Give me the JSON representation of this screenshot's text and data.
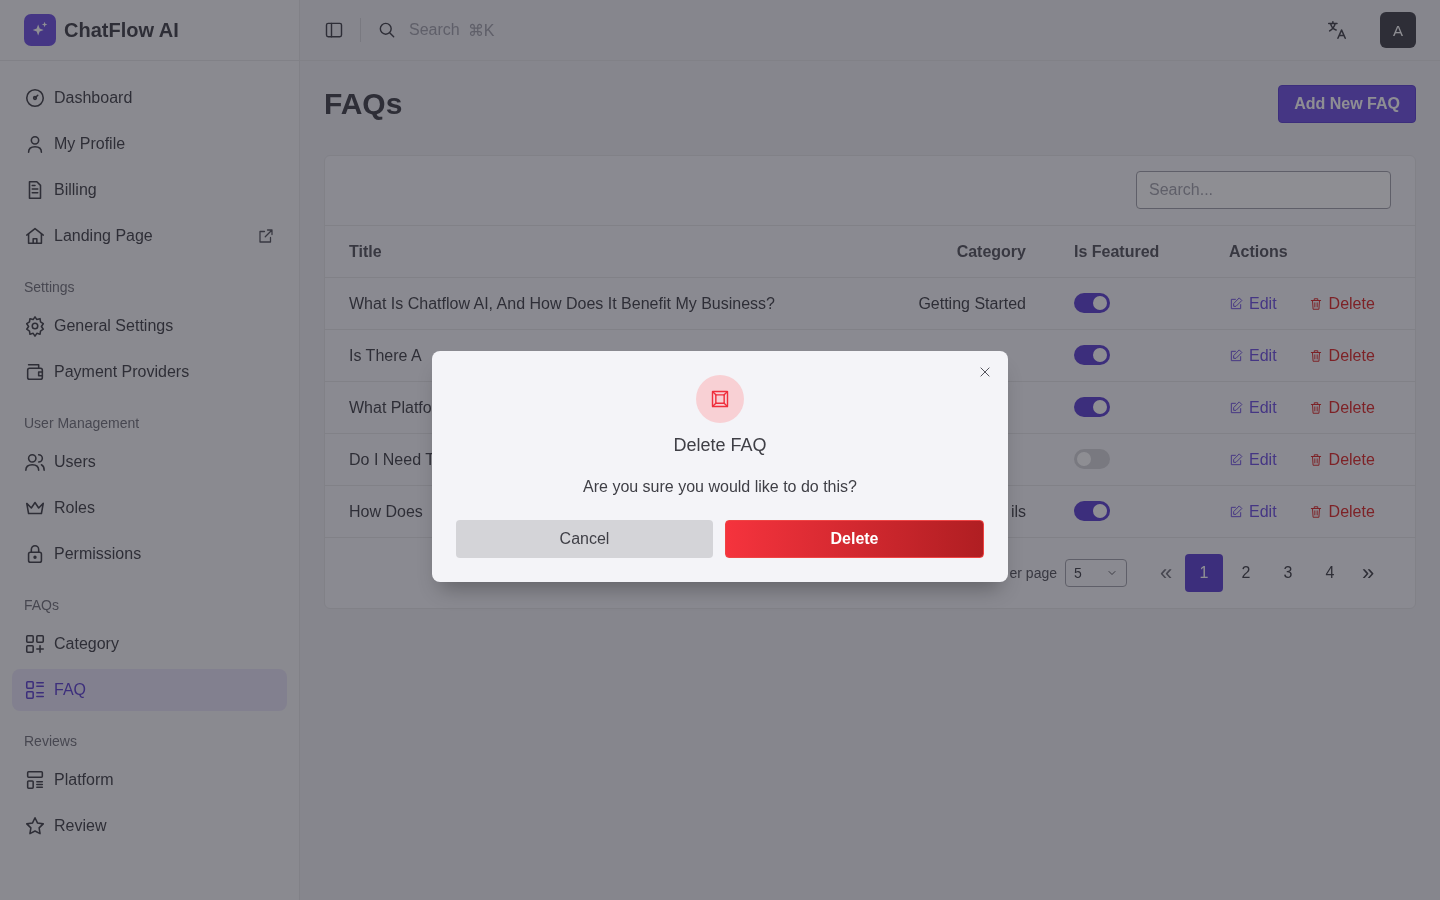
{
  "brand": {
    "name": "ChatFlow AI"
  },
  "topbar": {
    "search_placeholder": "Search",
    "shortcut": "⌘K",
    "avatar": "A"
  },
  "sidebar": {
    "sections": [
      {
        "items": [
          {
            "label": "Dashboard",
            "selected": false
          },
          {
            "label": "My Profile",
            "selected": false
          },
          {
            "label": "Billing",
            "selected": false
          },
          {
            "label": "Landing Page",
            "selected": false,
            "external": true
          }
        ]
      },
      {
        "heading": "Settings",
        "items": [
          {
            "label": "General Settings",
            "selected": false
          },
          {
            "label": "Payment Providers",
            "selected": false
          }
        ]
      },
      {
        "heading": "User Management",
        "items": [
          {
            "label": "Users",
            "selected": false
          },
          {
            "label": "Roles",
            "selected": false
          },
          {
            "label": "Permissions",
            "selected": false
          }
        ]
      },
      {
        "heading": "FAQs",
        "items": [
          {
            "label": "Category",
            "selected": false
          },
          {
            "label": "FAQ",
            "selected": true
          }
        ]
      },
      {
        "heading": "Reviews",
        "items": [
          {
            "label": "Platform",
            "selected": false
          },
          {
            "label": "Review",
            "selected": false
          }
        ]
      }
    ]
  },
  "page": {
    "title": "FAQs",
    "add_button": "Add New FAQ"
  },
  "table": {
    "search_placeholder": "Search...",
    "columns": [
      "Title",
      "Category",
      "Is Featured",
      "Actions"
    ],
    "rows": [
      {
        "title": "What Is Chatflow AI, And How Does It Benefit My Business?",
        "category": "Getting Started",
        "featured": true,
        "edit": "Edit",
        "delete": "Delete"
      },
      {
        "title": "Is There A",
        "featured": true,
        "edit": "Edit",
        "delete": "Delete"
      },
      {
        "title": "What Platfo",
        "featured": true,
        "edit": "Edit",
        "delete": "Delete"
      },
      {
        "title": "Do I Need T",
        "featured": false,
        "edit": "Edit",
        "delete": "Delete"
      },
      {
        "title": "How Does",
        "category": "ils",
        "featured": true,
        "edit": "Edit",
        "delete": "Delete"
      }
    ],
    "pagination": {
      "per_page_label": "er page",
      "per_page": "5",
      "first": "«",
      "last": "»",
      "pages": [
        {
          "label": "1",
          "selected": true
        },
        {
          "label": "2",
          "selected": false
        },
        {
          "label": "3",
          "selected": false
        },
        {
          "label": "4",
          "selected": false
        }
      ]
    }
  },
  "modal": {
    "title": "Delete FAQ",
    "message": "Are you sure you would like to do this?",
    "cancel": "Cancel",
    "confirm": "Delete"
  }
}
